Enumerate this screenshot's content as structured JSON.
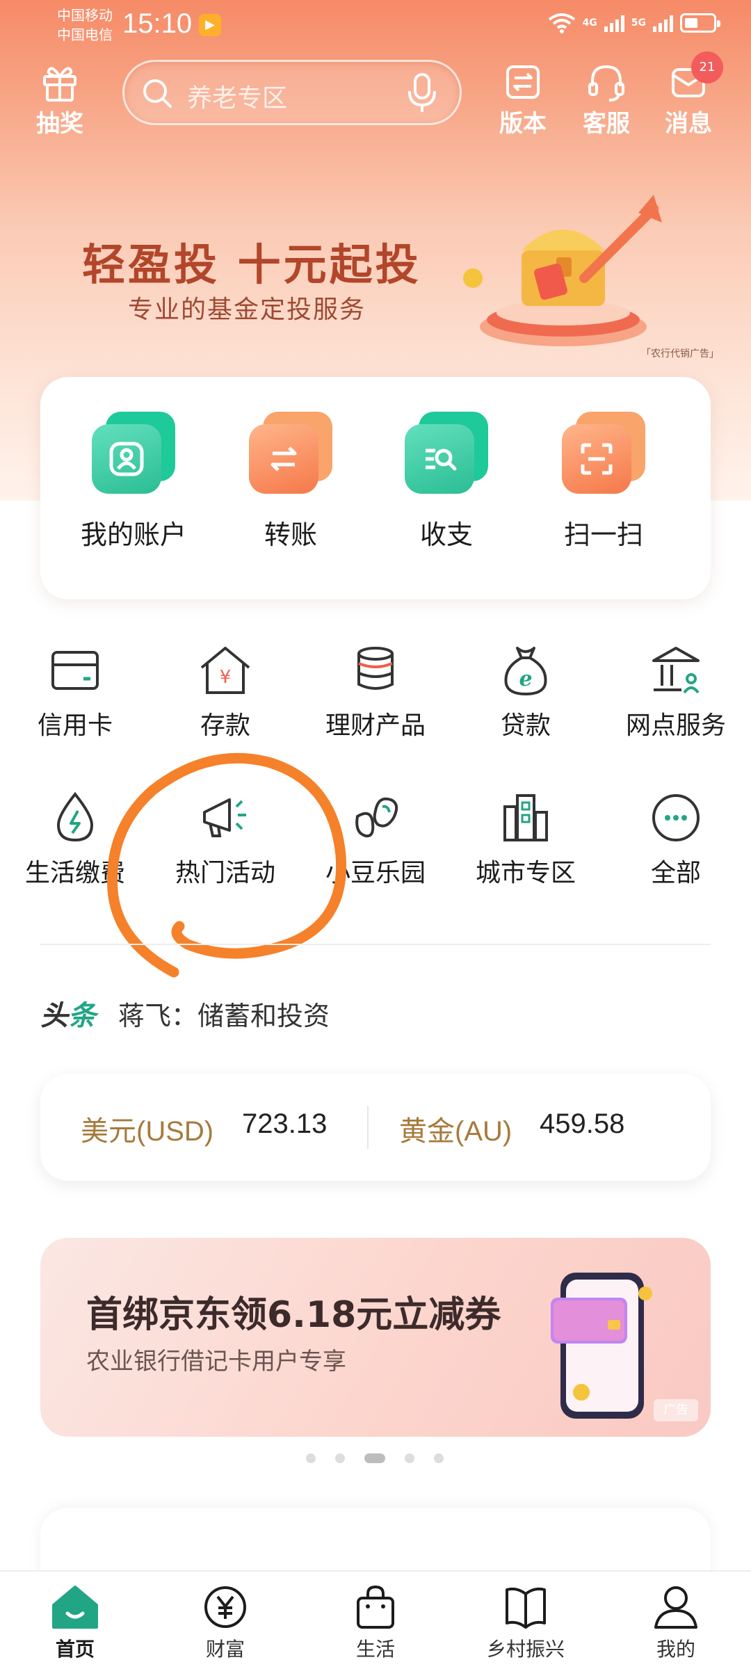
{
  "status_bar": {
    "carrier_1": "中国移动",
    "carrier_2": "中国电信",
    "time": "15:10",
    "net_1": "4G",
    "net_2": "5G"
  },
  "header": {
    "lottery_label": "抽奖",
    "search_placeholder": "养老专区",
    "version_label": "版本",
    "service_label": "客服",
    "message_label": "消息",
    "message_badge": "21"
  },
  "banner": {
    "title": "轻盈投  十元起投",
    "subtitle": "专业的基金定投服务",
    "ad_note": "「农行代销广告」"
  },
  "quick_actions": [
    {
      "label": "我的账户",
      "icon": "account-icon"
    },
    {
      "label": "转账",
      "icon": "transfer-icon"
    },
    {
      "label": "收支",
      "icon": "statement-icon"
    },
    {
      "label": "扫一扫",
      "icon": "scan-icon"
    }
  ],
  "services": [
    {
      "label": "信用卡",
      "icon": "credit-card-icon"
    },
    {
      "label": "存款",
      "icon": "deposit-icon"
    },
    {
      "label": "理财产品",
      "icon": "wealth-icon"
    },
    {
      "label": "贷款",
      "icon": "loan-icon"
    },
    {
      "label": "网点服务",
      "icon": "branch-icon"
    },
    {
      "label": "生活缴费",
      "icon": "utility-icon"
    },
    {
      "label": "热门活动",
      "icon": "megaphone-icon"
    },
    {
      "label": "小豆乐园",
      "icon": "beans-icon"
    },
    {
      "label": "城市专区",
      "icon": "city-icon"
    },
    {
      "label": "全部",
      "icon": "more-icon"
    }
  ],
  "headline": {
    "tag_1": "头",
    "tag_2": "条",
    "text": "蒋飞：储蓄和投资"
  },
  "rates": {
    "usd_label": "美元(USD)",
    "usd_value": "723.13",
    "gold_label": "黄金(AU)",
    "gold_value": "459.58"
  },
  "promo": {
    "title": "首绑京东领6.18元立减券",
    "subtitle": "农业银行借记卡用户专享",
    "ad_label": "广告"
  },
  "bottom_nav": [
    {
      "label": "首页",
      "icon": "home-icon"
    },
    {
      "label": "财富",
      "icon": "yuan-icon"
    },
    {
      "label": "生活",
      "icon": "shopping-bag-icon"
    },
    {
      "label": "乡村振兴",
      "icon": "book-icon"
    },
    {
      "label": "我的",
      "icon": "profile-icon"
    }
  ],
  "colors": {
    "brand_green": "#22a585",
    "header_orange": "#f68a67",
    "gold_text": "#a77a3b",
    "annotation_orange": "#f5812a"
  }
}
